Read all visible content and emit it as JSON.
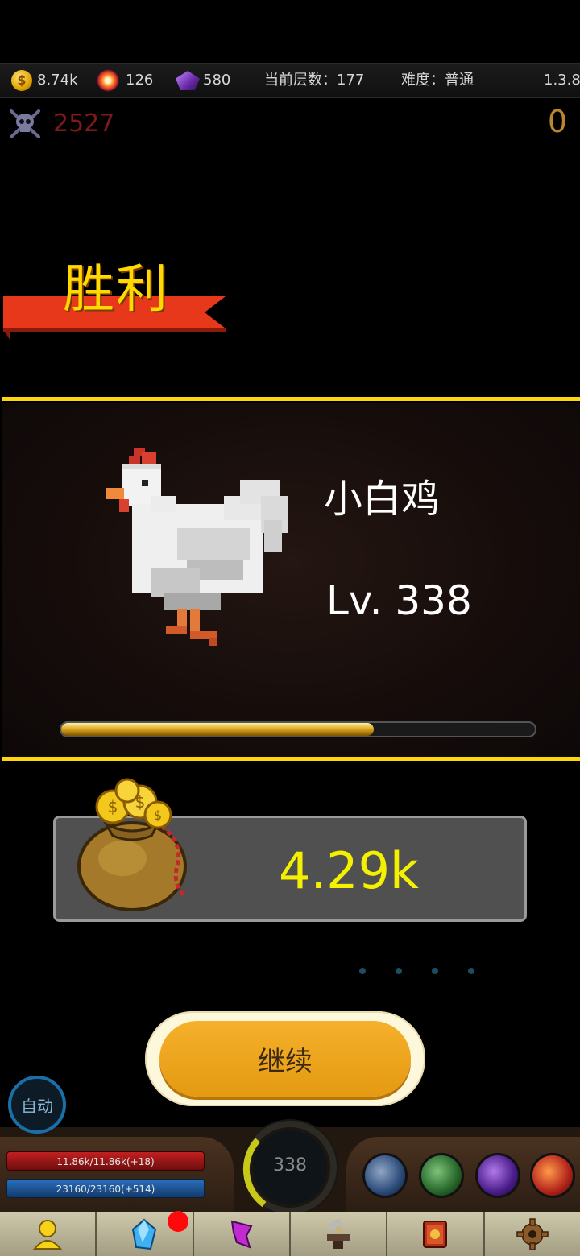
{
  "topbar": {
    "gold": "8.74k",
    "bombs": "126",
    "gems": "580",
    "floor_text": "当前层数：177",
    "difficulty_text": "难度：普通",
    "version": "1.3.8"
  },
  "kills": {
    "count": "2527",
    "right_counter": "0"
  },
  "result": {
    "title": "胜利"
  },
  "monster": {
    "name": "小白鸡",
    "level": "Lv. 338",
    "xp_progress": 0.66
  },
  "reward": {
    "gold": "4.29k"
  },
  "actions": {
    "continue_label": "继续",
    "auto_label": "自动"
  },
  "hud": {
    "hp": "11.86k/11.86k(+18)",
    "mp": "23160/23160(+514)",
    "player_level": "338"
  },
  "nav": {
    "items": [
      "hero-icon",
      "crystal-icon",
      "rune-icon",
      "anvil-icon",
      "book-icon",
      "gear-icon"
    ],
    "notification_color": "#ff0a0a"
  },
  "colors": {
    "accent_yellow": "#ffd60a",
    "reward_text": "#f3f000",
    "button": "#f0a51c"
  }
}
